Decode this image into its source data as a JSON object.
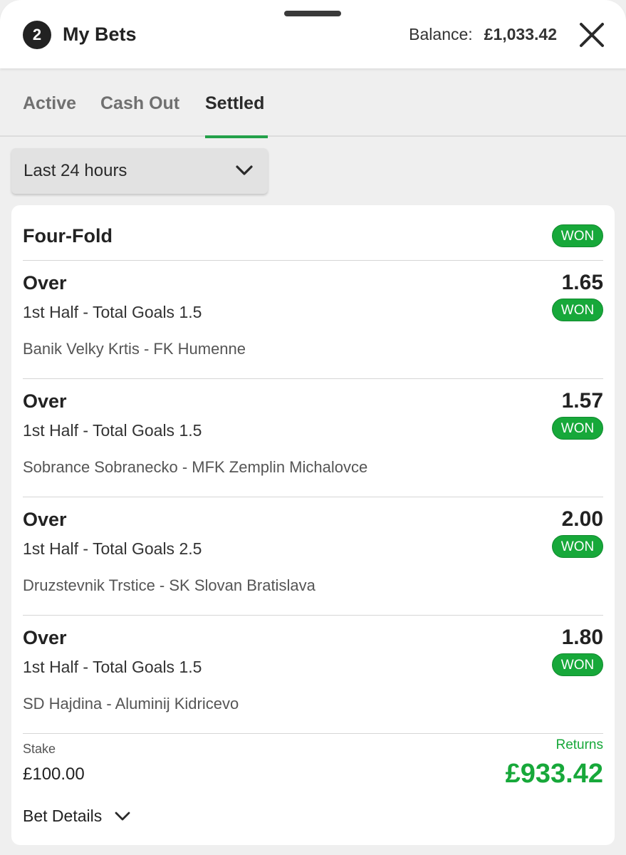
{
  "header": {
    "bet_count": "2",
    "title": "My Bets",
    "balance_label": "Balance:",
    "balance_value": "£1,033.42",
    "close_icon": "close-icon"
  },
  "tabs": [
    {
      "label": "Active",
      "active": false
    },
    {
      "label": "Cash Out",
      "active": false
    },
    {
      "label": "Settled",
      "active": true
    }
  ],
  "filter": {
    "selected": "Last 24 hours",
    "icon": "chevron-down-icon"
  },
  "bet": {
    "type": "Four-Fold",
    "status": "WON",
    "selections": [
      {
        "pick": "Over",
        "odds": "1.65",
        "market": "1st Half - Total Goals 1.5",
        "status": "WON",
        "event": "Banik Velky Krtis - FK Humenne"
      },
      {
        "pick": "Over",
        "odds": "1.57",
        "market": "1st Half - Total Goals 1.5",
        "status": "WON",
        "event": "Sobrance Sobranecko - MFK Zemplin Michalovce"
      },
      {
        "pick": "Over",
        "odds": "2.00",
        "market": "1st Half - Total Goals 2.5",
        "status": "WON",
        "event": "Druzstevnik Trstice - SK Slovan Bratislava"
      },
      {
        "pick": "Over",
        "odds": "1.80",
        "market": "1st Half - Total Goals 1.5",
        "status": "WON",
        "event": "SD Hajdina - Aluminij Kidricevo"
      }
    ],
    "stake_label": "Stake",
    "stake_value": "£100.00",
    "returns_label": "Returns",
    "returns_value": "£933.42",
    "details_label": "Bet Details"
  },
  "colors": {
    "accent_green": "#17a83a",
    "tab_underline": "#23a14a",
    "background": "#efefef"
  }
}
